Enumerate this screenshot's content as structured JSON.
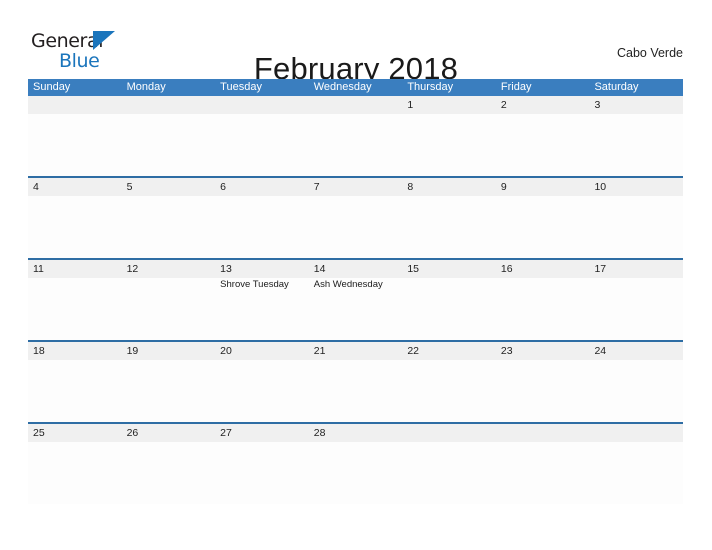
{
  "brand": {
    "word_general": "General",
    "word_blue": "Blue",
    "flag_icon": "triangle-flag-icon",
    "color_dark": "#231F20",
    "color_blue": "#1B75BC"
  },
  "header": {
    "title": "February 2018",
    "locale": "Cabo Verde"
  },
  "theme": {
    "header_blue": "#3A7EBF",
    "row_rule_blue": "#2E6DA4",
    "date_band_gray": "#F0F0F0",
    "page_background": "#FFFFFF"
  },
  "calendar": {
    "month": "February",
    "year": "2018",
    "weekday_headers": [
      "Sunday",
      "Monday",
      "Tuesday",
      "Wednesday",
      "Thursday",
      "Friday",
      "Saturday"
    ],
    "weeks": [
      {
        "days": [
          {
            "number": "",
            "events": []
          },
          {
            "number": "",
            "events": []
          },
          {
            "number": "",
            "events": []
          },
          {
            "number": "",
            "events": []
          },
          {
            "number": "1",
            "events": []
          },
          {
            "number": "2",
            "events": []
          },
          {
            "number": "3",
            "events": []
          }
        ]
      },
      {
        "days": [
          {
            "number": "4",
            "events": []
          },
          {
            "number": "5",
            "events": []
          },
          {
            "number": "6",
            "events": []
          },
          {
            "number": "7",
            "events": []
          },
          {
            "number": "8",
            "events": []
          },
          {
            "number": "9",
            "events": []
          },
          {
            "number": "10",
            "events": []
          }
        ]
      },
      {
        "days": [
          {
            "number": "11",
            "events": []
          },
          {
            "number": "12",
            "events": []
          },
          {
            "number": "13",
            "events": [
              "Shrove Tuesday"
            ]
          },
          {
            "number": "14",
            "events": [
              "Ash Wednesday"
            ]
          },
          {
            "number": "15",
            "events": []
          },
          {
            "number": "16",
            "events": []
          },
          {
            "number": "17",
            "events": []
          }
        ]
      },
      {
        "days": [
          {
            "number": "18",
            "events": []
          },
          {
            "number": "19",
            "events": []
          },
          {
            "number": "20",
            "events": []
          },
          {
            "number": "21",
            "events": []
          },
          {
            "number": "22",
            "events": []
          },
          {
            "number": "23",
            "events": []
          },
          {
            "number": "24",
            "events": []
          }
        ]
      },
      {
        "days": [
          {
            "number": "25",
            "events": []
          },
          {
            "number": "26",
            "events": []
          },
          {
            "number": "27",
            "events": []
          },
          {
            "number": "28",
            "events": []
          },
          {
            "number": "",
            "events": []
          },
          {
            "number": "",
            "events": []
          },
          {
            "number": "",
            "events": []
          }
        ]
      }
    ]
  }
}
